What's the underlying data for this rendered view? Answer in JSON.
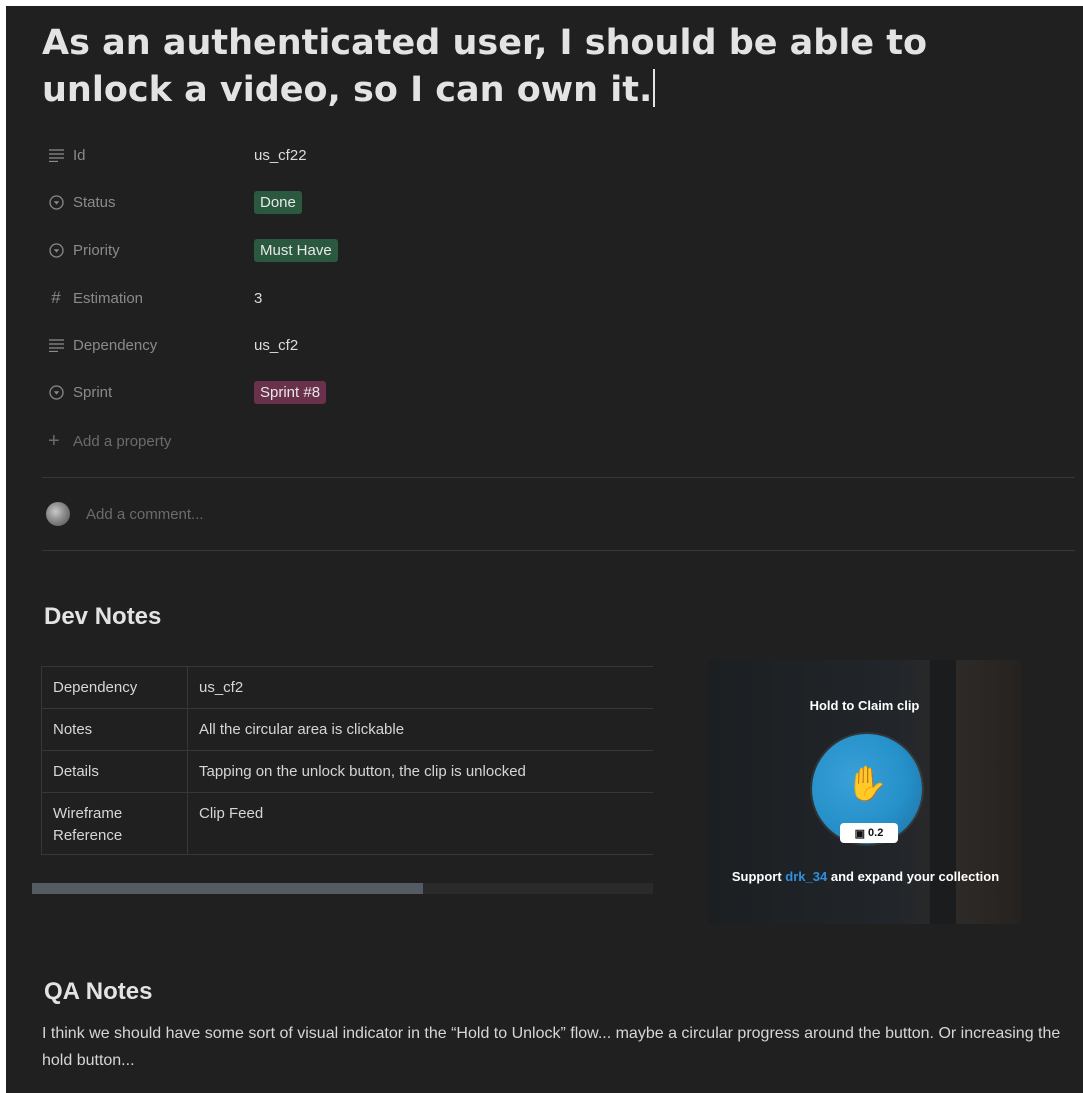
{
  "page": {
    "title": "As an authenticated user, I should be able to unlock a video, so I can own it."
  },
  "properties": [
    {
      "icon": "text-lines-icon",
      "label": "Id",
      "value": "us_cf22",
      "type": "text"
    },
    {
      "icon": "select-circle-icon",
      "label": "Status",
      "value": "Done",
      "type": "tag",
      "color": "#2b593f"
    },
    {
      "icon": "select-circle-icon",
      "label": "Priority",
      "value": "Must Have",
      "type": "tag",
      "color": "#2b593f"
    },
    {
      "icon": "hash-icon",
      "label": "Estimation",
      "value": "3",
      "type": "text"
    },
    {
      "icon": "text-lines-icon",
      "label": "Dependency",
      "value": "us_cf2",
      "type": "text"
    },
    {
      "icon": "select-circle-icon",
      "label": "Sprint",
      "value": "Sprint #8",
      "type": "tag",
      "color": "#69314c"
    }
  ],
  "add_property": {
    "icon": "plus-icon",
    "label": "Add a property"
  },
  "comment": {
    "placeholder": "Add a comment..."
  },
  "dev_notes": {
    "heading": "Dev Notes",
    "table": [
      {
        "key": "Dependency",
        "value": "us_cf2"
      },
      {
        "key": "Notes",
        "value": "All the circular area is clickable"
      },
      {
        "key": "Details",
        "value": "Tapping on the unlock button, the clip is unlocked"
      },
      {
        "key": "Wireframe Reference",
        "value": "Clip Feed"
      }
    ],
    "scroll_fraction": 0.63
  },
  "screenshot": {
    "hold_text": "Hold to Claim clip",
    "price": "0.2",
    "support_prefix": "Support",
    "support_user": "drk_34",
    "support_suffix": "and expand your collection"
  },
  "qa_notes": {
    "heading": "QA Notes",
    "text": "I think we should have some sort of visual indicator in the “Hold to Unlock” flow... maybe a circular progress around the button. Or increasing the hold button..."
  },
  "colors": {
    "background": "#202020",
    "tag_green": "#2b593f",
    "tag_pink": "#69314c",
    "accent_blue": "#2f8fe0"
  }
}
